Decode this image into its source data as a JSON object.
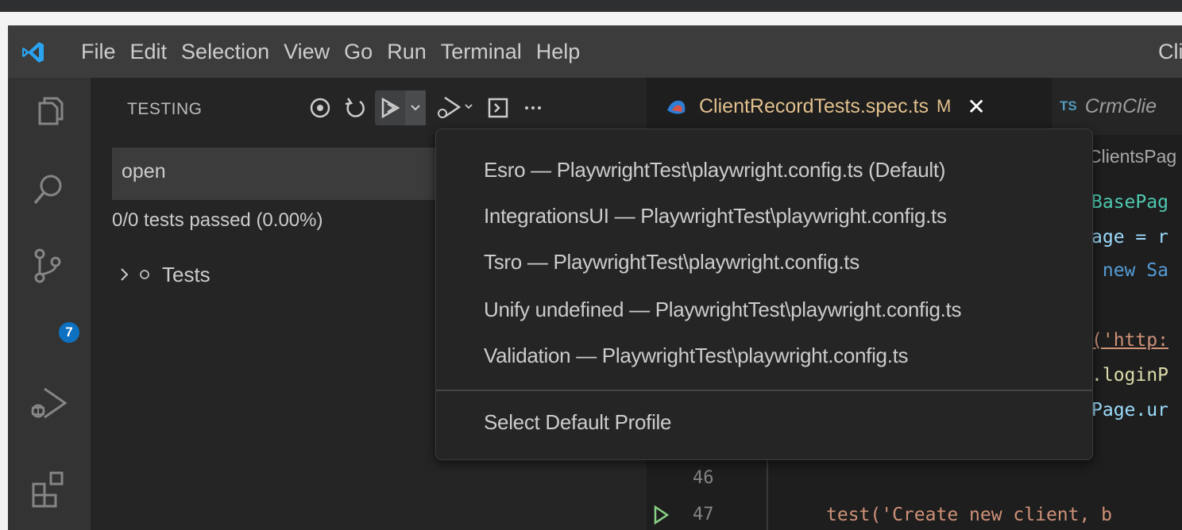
{
  "menu": [
    "File",
    "Edit",
    "Selection",
    "View",
    "Go",
    "Run",
    "Terminal",
    "Help"
  ],
  "window_title": "Cli",
  "sidebar": {
    "title": "TESTING",
    "filter_value": "open",
    "summary": "0/0 tests passed (0.00%)",
    "tree": {
      "label": "Tests"
    }
  },
  "activity": {
    "source_control_badge": "7"
  },
  "tabs": {
    "active": {
      "name": "ClientRecordTests.spec.ts",
      "modified": "M",
      "close": "✕"
    },
    "second": {
      "prefix": "TS",
      "name": "CrmClie"
    }
  },
  "breadcrumb": "ClientsPag",
  "code_lines": [
    "BasePag",
    "age = r",
    " new Sa",
    "('http:",
    ".loginP",
    "Page.ur"
  ],
  "line_numbers": [
    "46",
    "47"
  ],
  "code_line_47": "test('Create new client, b",
  "dropdown": {
    "items": [
      "Esro — PlaywrightTest\\playwright.config.ts (Default)",
      "IntegrationsUI — PlaywrightTest\\playwright.config.ts",
      "Tsro — PlaywrightTest\\playwright.config.ts",
      "Unify undefined — PlaywrightTest\\playwright.config.ts",
      "Validation — PlaywrightTest\\playwright.config.ts"
    ],
    "footer": "Select Default Profile"
  },
  "colors": {
    "titlebar": "#3c3c3c",
    "activitybar": "#333333",
    "sidebar": "#252526",
    "editor": "#1e1e1e",
    "accent_blue": "#0e70c0",
    "modified": "#e2c08d",
    "run_green": "#89d185"
  },
  "icons": [
    "vscode-logo-icon",
    "explorer-icon",
    "search-icon",
    "source-control-icon",
    "run-debug-icon",
    "extensions-icon",
    "show-output-icon",
    "refresh-icon",
    "run-tests-icon",
    "debug-tests-icon",
    "open-terminal-icon",
    "more-icon",
    "playwright-icon"
  ]
}
